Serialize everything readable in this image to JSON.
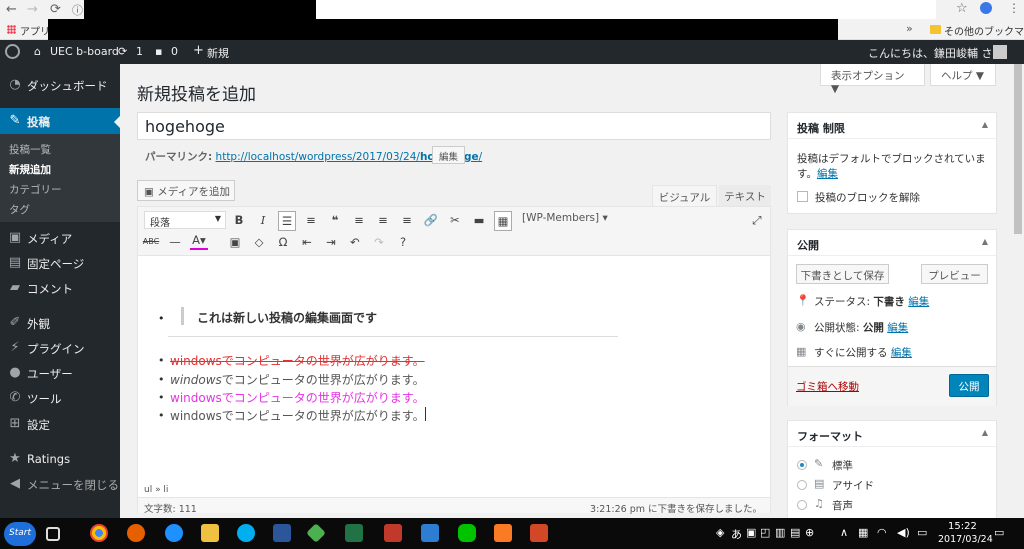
{
  "browser": {
    "apps_label": "アプリ",
    "other_bookmarks": "その他のブックマーク",
    "more": "»"
  },
  "adminbar": {
    "site_name": "UEC b-board",
    "updates_count": "1",
    "comments_count": "0",
    "new_label": "新規",
    "greeting": "こんにちは、鎌田峻輔 さん"
  },
  "sidebar": {
    "dashboard": "ダッシュボード",
    "posts": "投稿",
    "sub_all": "投稿一覧",
    "sub_new": "新規追加",
    "sub_categories": "カテゴリー",
    "sub_tags": "タグ",
    "media": "メディア",
    "pages": "固定ページ",
    "comments": "コメント",
    "appearance": "外観",
    "plugins": "プラグイン",
    "users": "ユーザー",
    "tools": "ツール",
    "settings": "設定",
    "ratings": "Ratings",
    "collapse": "メニューを閉じる"
  },
  "main": {
    "page_title": "新規投稿を追加",
    "screen_options": "表示オプション ▼",
    "help": "ヘルプ ▼",
    "title_value": "hogehoge",
    "permalink_label": "パーマリンク:",
    "permalink_base": "http://localhost/wordpress/2017/03/24/",
    "permalink_slug": "hogehoge",
    "permalink_end": "/",
    "edit_slug": "編集",
    "add_media": "メディアを追加",
    "tab_visual": "ビジュアル",
    "tab_text": "テキスト"
  },
  "toolbar": {
    "format": "段落",
    "wp_members": "[WP-Members] ▾"
  },
  "content": {
    "quote": "これは新しい投稿の編集画面です",
    "li1": "windowsでコンピュータの世界が広がります。",
    "li2_italic": "windows",
    "li2_rest": "でコンピュータの世界が広がります。",
    "li3": "windowsでコンピュータの世界が広がります。",
    "li4": "windowsでコンピュータの世界が広がります。"
  },
  "status": {
    "path": "ul » li",
    "word_count": "文字数: 111",
    "autosave": "3:21:26 pm に下書きを保存しました。"
  },
  "box_restrict": {
    "title": "投稿 制限",
    "desc": "投稿はデフォルトでブロックされていま",
    "desc2_suffix": "す。",
    "edit": "編集",
    "unblock": "投稿のブロックを解除"
  },
  "box_publish": {
    "title": "公開",
    "save_draft": "下書きとして保存",
    "preview": "プレビュー",
    "status_label": "ステータス:",
    "status_value": "下書き",
    "visibility_label": "公開状態:",
    "visibility_value": "公開",
    "schedule": "すぐに公開する",
    "edit": "編集",
    "trash": "ゴミ箱へ移動",
    "publish": "公開"
  },
  "box_format": {
    "title": "フォーマット",
    "opt1": "標準",
    "opt2": "アサイド",
    "opt3": "音声"
  },
  "taskbar": {
    "start": "Start",
    "ime": "あ",
    "time": "15:22",
    "date": "2017/03/24"
  },
  "colors": {
    "wp_dark": "#23282d",
    "wp_blue": "#0073aa",
    "strike_red": "#e13232",
    "magenta": "#e633e6"
  }
}
